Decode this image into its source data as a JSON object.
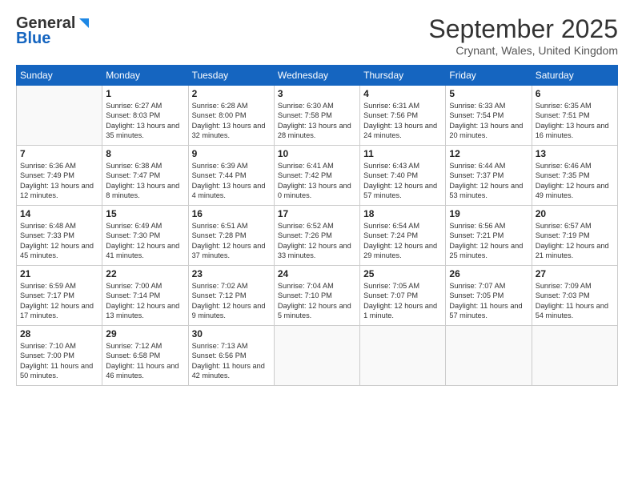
{
  "header": {
    "logo_general": "General",
    "logo_blue": "Blue",
    "month_title": "September 2025",
    "location": "Crynant, Wales, United Kingdom"
  },
  "days_of_week": [
    "Sunday",
    "Monday",
    "Tuesday",
    "Wednesday",
    "Thursday",
    "Friday",
    "Saturday"
  ],
  "weeks": [
    [
      {
        "day": null
      },
      {
        "day": 1,
        "sunrise": "6:27 AM",
        "sunset": "8:03 PM",
        "daylight": "13 hours and 35 minutes."
      },
      {
        "day": 2,
        "sunrise": "6:28 AM",
        "sunset": "8:00 PM",
        "daylight": "13 hours and 32 minutes."
      },
      {
        "day": 3,
        "sunrise": "6:30 AM",
        "sunset": "7:58 PM",
        "daylight": "13 hours and 28 minutes."
      },
      {
        "day": 4,
        "sunrise": "6:31 AM",
        "sunset": "7:56 PM",
        "daylight": "13 hours and 24 minutes."
      },
      {
        "day": 5,
        "sunrise": "6:33 AM",
        "sunset": "7:54 PM",
        "daylight": "13 hours and 20 minutes."
      },
      {
        "day": 6,
        "sunrise": "6:35 AM",
        "sunset": "7:51 PM",
        "daylight": "13 hours and 16 minutes."
      }
    ],
    [
      {
        "day": 7,
        "sunrise": "6:36 AM",
        "sunset": "7:49 PM",
        "daylight": "13 hours and 12 minutes."
      },
      {
        "day": 8,
        "sunrise": "6:38 AM",
        "sunset": "7:47 PM",
        "daylight": "13 hours and 8 minutes."
      },
      {
        "day": 9,
        "sunrise": "6:39 AM",
        "sunset": "7:44 PM",
        "daylight": "13 hours and 4 minutes."
      },
      {
        "day": 10,
        "sunrise": "6:41 AM",
        "sunset": "7:42 PM",
        "daylight": "13 hours and 0 minutes."
      },
      {
        "day": 11,
        "sunrise": "6:43 AM",
        "sunset": "7:40 PM",
        "daylight": "12 hours and 57 minutes."
      },
      {
        "day": 12,
        "sunrise": "6:44 AM",
        "sunset": "7:37 PM",
        "daylight": "12 hours and 53 minutes."
      },
      {
        "day": 13,
        "sunrise": "6:46 AM",
        "sunset": "7:35 PM",
        "daylight": "12 hours and 49 minutes."
      }
    ],
    [
      {
        "day": 14,
        "sunrise": "6:48 AM",
        "sunset": "7:33 PM",
        "daylight": "12 hours and 45 minutes."
      },
      {
        "day": 15,
        "sunrise": "6:49 AM",
        "sunset": "7:30 PM",
        "daylight": "12 hours and 41 minutes."
      },
      {
        "day": 16,
        "sunrise": "6:51 AM",
        "sunset": "7:28 PM",
        "daylight": "12 hours and 37 minutes."
      },
      {
        "day": 17,
        "sunrise": "6:52 AM",
        "sunset": "7:26 PM",
        "daylight": "12 hours and 33 minutes."
      },
      {
        "day": 18,
        "sunrise": "6:54 AM",
        "sunset": "7:24 PM",
        "daylight": "12 hours and 29 minutes."
      },
      {
        "day": 19,
        "sunrise": "6:56 AM",
        "sunset": "7:21 PM",
        "daylight": "12 hours and 25 minutes."
      },
      {
        "day": 20,
        "sunrise": "6:57 AM",
        "sunset": "7:19 PM",
        "daylight": "12 hours and 21 minutes."
      }
    ],
    [
      {
        "day": 21,
        "sunrise": "6:59 AM",
        "sunset": "7:17 PM",
        "daylight": "12 hours and 17 minutes."
      },
      {
        "day": 22,
        "sunrise": "7:00 AM",
        "sunset": "7:14 PM",
        "daylight": "12 hours and 13 minutes."
      },
      {
        "day": 23,
        "sunrise": "7:02 AM",
        "sunset": "7:12 PM",
        "daylight": "12 hours and 9 minutes."
      },
      {
        "day": 24,
        "sunrise": "7:04 AM",
        "sunset": "7:10 PM",
        "daylight": "12 hours and 5 minutes."
      },
      {
        "day": 25,
        "sunrise": "7:05 AM",
        "sunset": "7:07 PM",
        "daylight": "12 hours and 1 minute."
      },
      {
        "day": 26,
        "sunrise": "7:07 AM",
        "sunset": "7:05 PM",
        "daylight": "11 hours and 57 minutes."
      },
      {
        "day": 27,
        "sunrise": "7:09 AM",
        "sunset": "7:03 PM",
        "daylight": "11 hours and 54 minutes."
      }
    ],
    [
      {
        "day": 28,
        "sunrise": "7:10 AM",
        "sunset": "7:00 PM",
        "daylight": "11 hours and 50 minutes."
      },
      {
        "day": 29,
        "sunrise": "7:12 AM",
        "sunset": "6:58 PM",
        "daylight": "11 hours and 46 minutes."
      },
      {
        "day": 30,
        "sunrise": "7:13 AM",
        "sunset": "6:56 PM",
        "daylight": "11 hours and 42 minutes."
      },
      {
        "day": null
      },
      {
        "day": null
      },
      {
        "day": null
      },
      {
        "day": null
      }
    ]
  ]
}
